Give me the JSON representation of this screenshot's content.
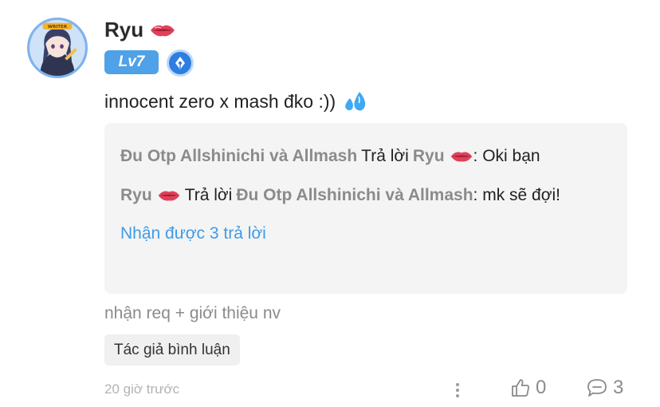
{
  "comment": {
    "username": "Ryu",
    "username_emoji": "lips-icon",
    "level": "Lv7",
    "title_badge_icon": "pen-nib-badge-icon",
    "avatar_badge_text": "WRITER",
    "text": "innocent zero x mash đko :))",
    "text_emoji": "sweat-droplets-icon",
    "tag_line": "nhận req + giới thiệu nv",
    "author_tag": "Tác giả bình luận",
    "time": "20 giờ trước",
    "likes": "0",
    "reply_count": "3"
  },
  "replies": {
    "items": [
      {
        "author": "Đu Otp Allshinichi và Allmash",
        "action": "Trả lời",
        "target": "Ryu",
        "target_emoji": "lips-icon",
        "text": ": Oki bạn"
      },
      {
        "author": "Ryu",
        "author_emoji": "lips-icon",
        "action": "Trả lời",
        "target": "Đu Otp Allshinichi và Allmash",
        "text": ": mk sẽ đợi!"
      }
    ],
    "more_label": "Nhận được 3 trả lời"
  },
  "colors": {
    "accent_blue": "#3f9be7",
    "level_badge": "#4fa1e8",
    "name_gray": "#8b8b8b",
    "reply_bg": "#f4f4f5",
    "lips_red": "#e0405a"
  }
}
